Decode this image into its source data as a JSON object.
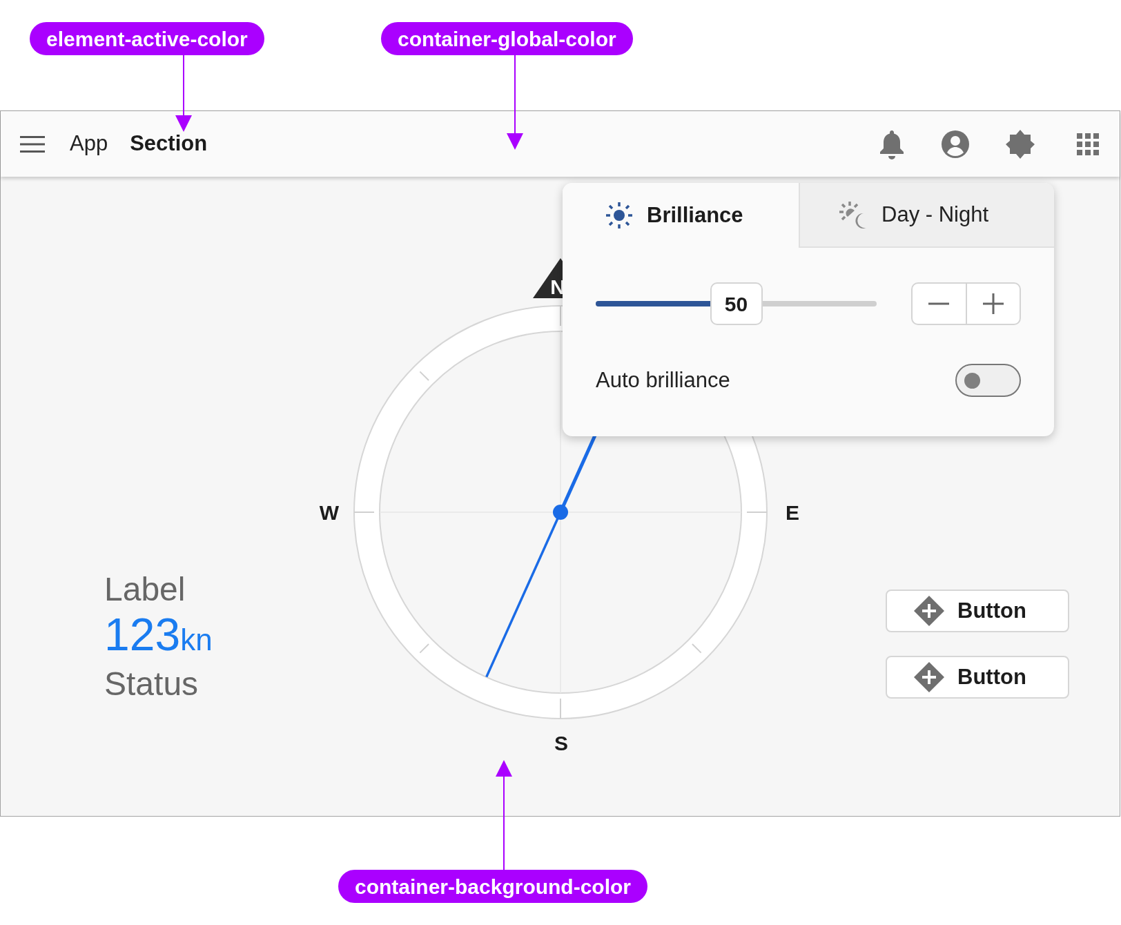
{
  "annotations": [
    {
      "label": "element-active-color"
    },
    {
      "label": "container-global-color"
    },
    {
      "label": "container-background-color"
    }
  ],
  "app_bar": {
    "app_name": "App",
    "section": "Section"
  },
  "popup": {
    "tabs": [
      {
        "label": "Brilliance",
        "selected": true
      },
      {
        "label": "Day - Night",
        "selected": false
      }
    ],
    "slider": {
      "level": 0.5,
      "value": "50"
    },
    "auto_brilliance": {
      "label": "Auto brilliance",
      "on": false
    }
  },
  "compass": {
    "north": "N",
    "west": "W",
    "east": "E",
    "south": "S"
  },
  "readout": {
    "label": "Label",
    "value": "123",
    "unit": "kn",
    "status": "Status"
  },
  "buttons": [
    {
      "label": "Button"
    },
    {
      "label": "Button"
    }
  ]
}
